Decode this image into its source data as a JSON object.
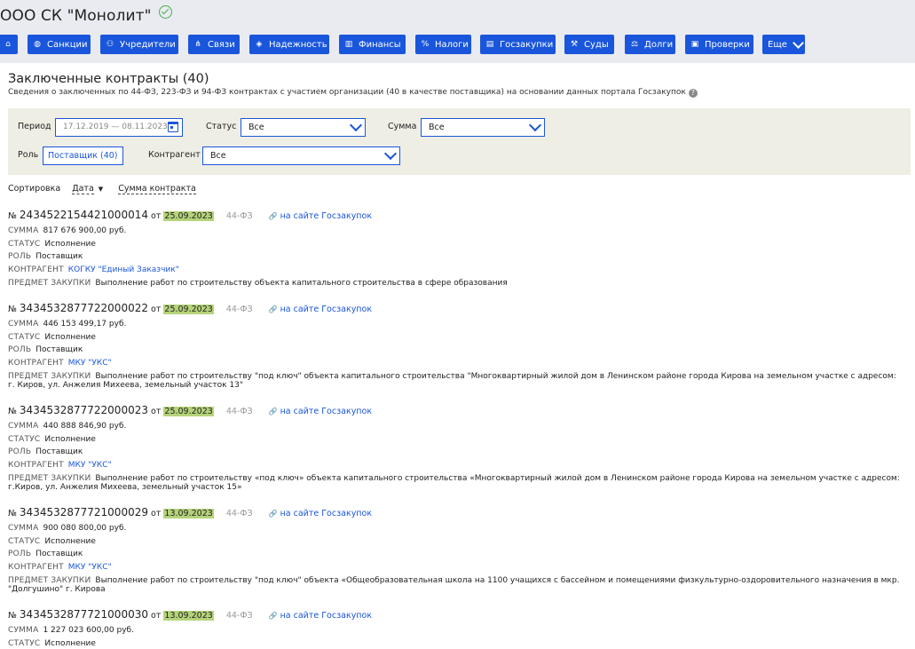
{
  "header": {
    "org_name": "ООО СК \"Монолит\"",
    "nav": [
      {
        "label": "",
        "icon": "home-icon",
        "glyph": "⌂"
      },
      {
        "label": "Санкции",
        "icon": "globe-icon",
        "glyph": "◍"
      },
      {
        "label": "Учредители",
        "icon": "users-icon",
        "glyph": "⚇"
      },
      {
        "label": "Связи",
        "icon": "connections-icon",
        "glyph": "⋔"
      },
      {
        "label": "Надежность",
        "icon": "shield-icon",
        "glyph": "◈"
      },
      {
        "label": "Финансы",
        "icon": "chart-icon",
        "glyph": "▥"
      },
      {
        "label": "Налоги",
        "icon": "percent-icon",
        "glyph": "%"
      },
      {
        "label": "Госзакупки",
        "icon": "procurement-icon",
        "glyph": "▤"
      },
      {
        "label": "Суды",
        "icon": "gavel-icon",
        "glyph": "⚒"
      },
      {
        "label": "Долги",
        "icon": "scales-icon",
        "glyph": "⚖"
      },
      {
        "label": "Проверки",
        "icon": "checklist-icon",
        "glyph": "▣"
      },
      {
        "label": "Еще",
        "icon": "chevron-down-icon",
        "glyph": ""
      }
    ]
  },
  "section": {
    "title": "Заключенные контракты (40)",
    "subtitle": "Сведения о заключенных по 44-ФЗ, 223-ФЗ и 94-ФЗ контрактах с участием организации (40 в качестве поставщика) на основании данных портала Госзакупок",
    "help_glyph": "?"
  },
  "filters": {
    "period_label": "Период",
    "period_value": "17.12.2019 — 08.11.2023",
    "status_label": "Статус",
    "status_value": "Все",
    "sum_label": "Сумма",
    "sum_value": "Все",
    "role_label": "Роль",
    "role_value": "Поставщик (40)",
    "counterparty_label": "Контрагент",
    "counterparty_value": "Все"
  },
  "sort": {
    "label": "Сортировка",
    "date_option": "Дата",
    "date_arrow": "▼",
    "sum_option": "Сумма контракта"
  },
  "labels": {
    "num_prefix": "№",
    "from": "от",
    "sum": "Сумма",
    "status": "Статус",
    "role": "Роль",
    "counterparty": "Контрагент",
    "subject": "Предмет закупки",
    "site_link": "на сайте Госзакупок",
    "link_glyph": "🔗"
  },
  "contracts": [
    {
      "number": "2434522154421000014",
      "date": "25.09.2023",
      "law": "44-ФЗ",
      "sum": "817 676 900,00 руб.",
      "status": "Исполнение",
      "role": "Поставщик",
      "counterparty": "КОГКУ \"Единый Заказчик\"",
      "subject": "Выполнение работ по строительству объекта капитального строительства в сфере образования"
    },
    {
      "number": "3434532877722000022",
      "date": "25.09.2023",
      "law": "44-ФЗ",
      "sum": "446 153 499,17 руб.",
      "status": "Исполнение",
      "role": "Поставщик",
      "counterparty": "МКУ \"УКС\"",
      "subject": "Выполнение работ по строительству \"под ключ\" объекта капитального строительства \"Многоквартирный жилой дом в Ленинском районе города Кирова на земельном участке с адресом: г. Киров, ул. Анжелия Михеева, земельный участок 13\""
    },
    {
      "number": "3434532877722000023",
      "date": "25.09.2023",
      "law": "44-ФЗ",
      "sum": "440 888 846,90 руб.",
      "status": "Исполнение",
      "role": "Поставщик",
      "counterparty": "МКУ \"УКС\"",
      "subject": "Выполнение работ по строительству «под ключ» объекта капитального строительства «Многоквартирный жилой дом в Ленинском районе города Кирова на земельном участке с адресом: г.Киров, ул. Анжелия Михеева, земельный участок 15»"
    },
    {
      "number": "3434532877721000029",
      "date": "13.09.2023",
      "law": "44-ФЗ",
      "sum": "900 080 800,00 руб.",
      "status": "Исполнение",
      "role": "Поставщик",
      "counterparty": "МКУ \"УКС\"",
      "subject": "Выполнение работ по строительству \"под ключ\" объекта «Общеобразовательная школа на 1100 учащихся с бассейном и помещениями физкультурно-оздоровительного назначения в мкр. \"Долгушино\" г. Кирова"
    },
    {
      "number": "3434532877721000030",
      "date": "13.09.2023",
      "law": "44-ФЗ",
      "sum": "1 227 023 600,00 руб.",
      "status": "Исполнение",
      "role": "",
      "counterparty": "",
      "subject": ""
    }
  ]
}
